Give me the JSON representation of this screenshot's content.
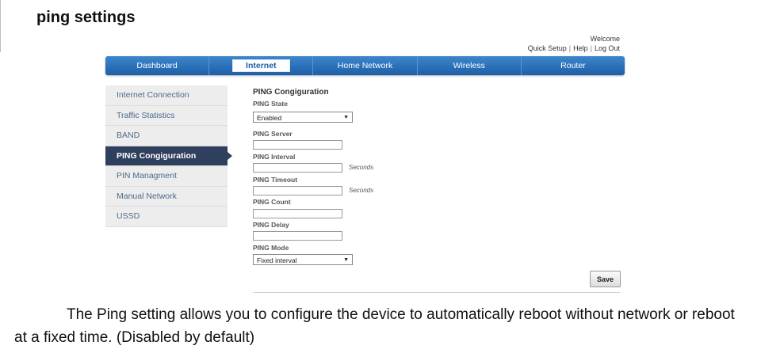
{
  "heading": "ping settings",
  "header": {
    "welcome": "Welcome",
    "links": [
      "Quick Setup",
      "Help",
      "Log Out"
    ]
  },
  "nav": {
    "tabs": [
      "Dashboard",
      "Internet",
      "Home Network",
      "Wireless",
      "Router"
    ],
    "active": "Internet"
  },
  "sidebar": {
    "items": [
      "Internet Connection",
      "Traffic Statistics",
      "BAND",
      "PING Congiguration",
      "PIN Managment",
      "Manual Network",
      "USSD"
    ],
    "active": "PING Congiguration"
  },
  "form": {
    "title": "PING Congiguration",
    "state_label": "PING State",
    "state_value": "Enabled",
    "server_label": "PING Server",
    "interval_label": "PING Interval",
    "interval_unit": "Seconds",
    "timeout_label": "PING Timeout",
    "timeout_unit": "Seconds",
    "count_label": "PING Count",
    "delay_label": "PING Delay",
    "mode_label": "PING Mode",
    "mode_value": "Fixed interval",
    "save_label": "Save"
  },
  "description": "The Ping setting allows you to configure the device to automatically reboot without network or reboot at a fixed time. (Disabled by default)"
}
